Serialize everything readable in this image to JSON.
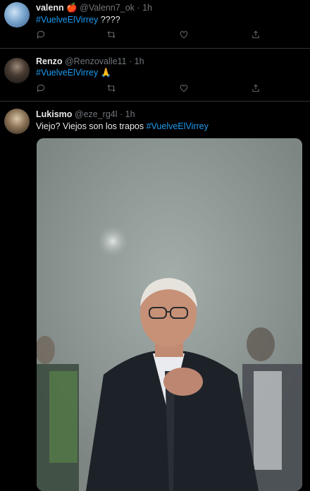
{
  "tweets": [
    {
      "name": "valenn 🍎",
      "handle": "@Valenn7_ok",
      "time": "1h",
      "text_prefix": "",
      "hashtag": "#VuelveElVirrey",
      "text_suffix": " ????"
    },
    {
      "name": "Renzo",
      "handle": "@Renzovalle11",
      "time": "1h",
      "text_prefix": "",
      "hashtag": "#VuelveElVirrey",
      "text_suffix": " 🙏"
    },
    {
      "name": "Lukismo",
      "handle": "@eze_rg4l",
      "time": "1h",
      "text_prefix": "Viejo? Viejos son los trapos ",
      "hashtag": "#VuelveElVirrey",
      "text_suffix": ""
    }
  ],
  "separator": "·",
  "icons": [
    "reply-icon",
    "retweet-icon",
    "like-icon",
    "share-icon"
  ],
  "colors": {
    "background": "#000000",
    "text": "#e7e9ea",
    "muted": "#71767b",
    "link": "#1d9bf0",
    "divider": "#2f3336"
  }
}
